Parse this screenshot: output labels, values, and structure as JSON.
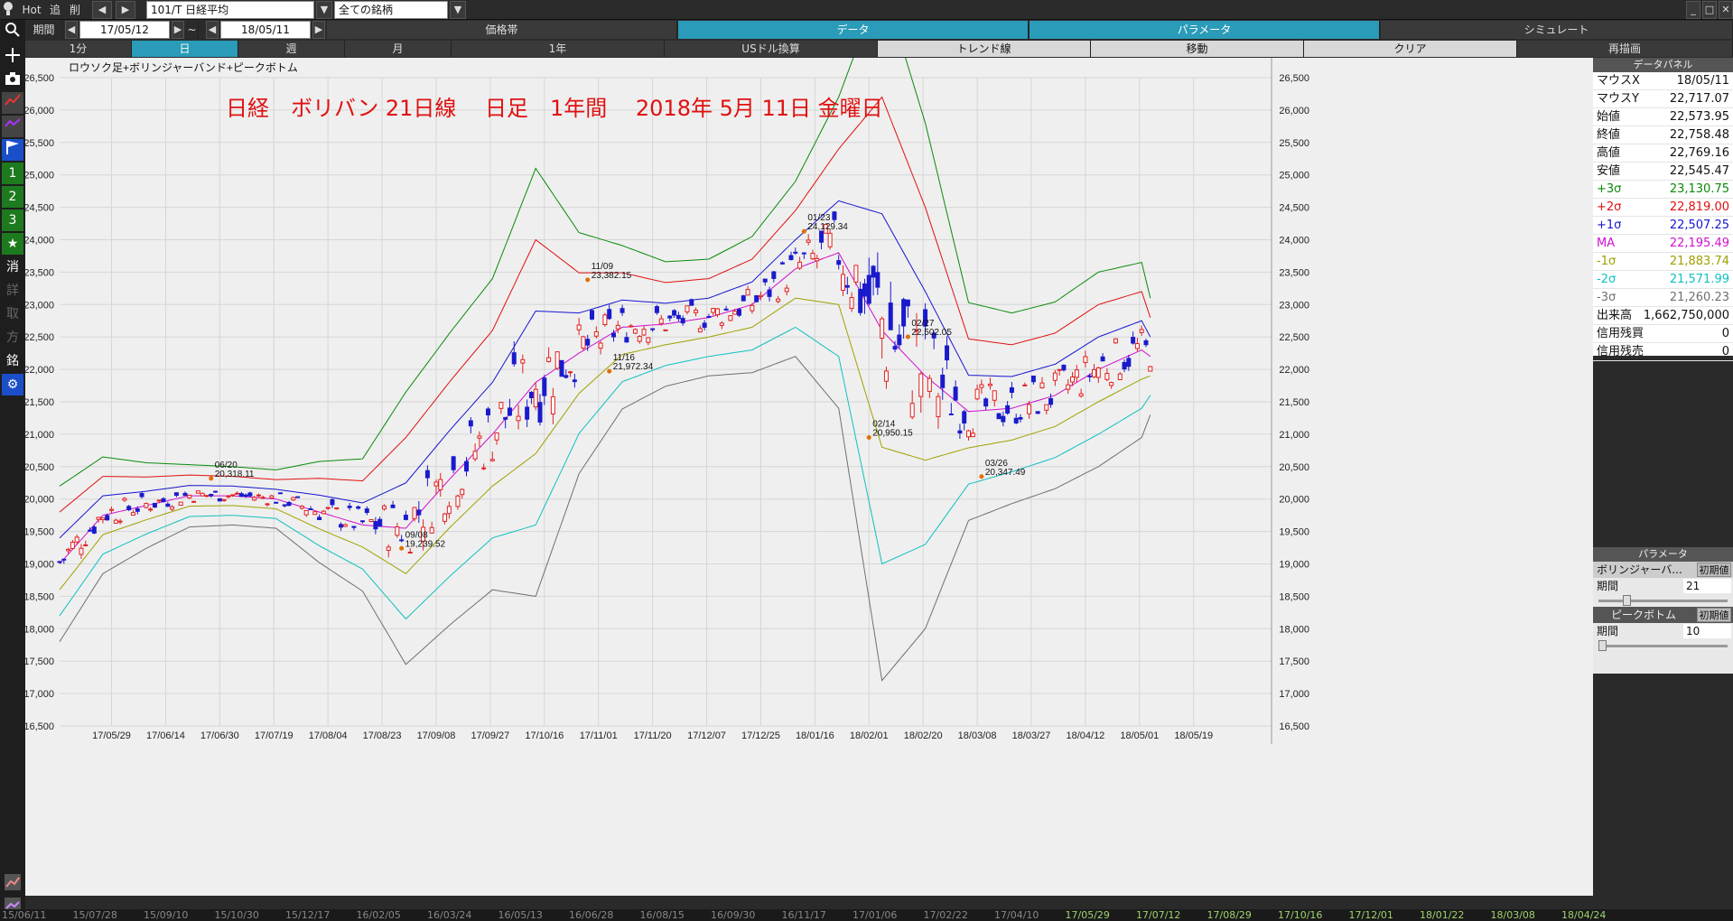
{
  "topbar": {
    "hot": "Hot",
    "tsui": "追",
    "sakujo": "削",
    "symbol": "101/T 日経平均",
    "filter": "全ての銘柄",
    "window_min": "_",
    "window_max": "□",
    "window_close": "✕"
  },
  "period_bar": {
    "label": "期間",
    "from": "17/05/12",
    "tilde": "~",
    "to": "18/05/11"
  },
  "headers": {
    "kakaku": "価格帯",
    "data": "データ",
    "param": "パラメータ",
    "sim": "シミュレート"
  },
  "tabs": {
    "t1": "1分",
    "t2": "日",
    "t3": "週",
    "t4": "月",
    "t5": "1年",
    "t6": "USドル換算",
    "t7": "トレンド線",
    "t8": "移動",
    "t9": "クリア",
    "t10": "再描画"
  },
  "chart_data": {
    "type": "candlestick",
    "subtitle": "ロウソク足+ボリンジャーバンド+ピークボトム",
    "title": "日経　ボリバン 21日線　 日足　1年間　 2018年 5月 11日 金曜日",
    "ylim": [
      16500,
      26500
    ],
    "yticks": [
      "26,500",
      "26,000",
      "25,500",
      "25,000",
      "24,500",
      "24,000",
      "23,500",
      "23,000",
      "22,500",
      "22,000",
      "21,500",
      "21,000",
      "20,500",
      "20,000",
      "19,500",
      "19,000",
      "18,500",
      "18,000",
      "17,500",
      "17,000",
      "16,500"
    ],
    "xticks": [
      "17/05/29",
      "17/06/14",
      "17/06/30",
      "17/07/19",
      "17/08/04",
      "17/08/23",
      "17/09/08",
      "17/09/27",
      "17/10/16",
      "17/11/01",
      "17/11/20",
      "17/12/07",
      "17/12/25",
      "18/01/16",
      "18/02/01",
      "18/02/20",
      "18/03/08",
      "18/03/27",
      "18/04/12",
      "18/05/01",
      "18/05/19"
    ],
    "series_colors": {
      "plus3": "#0a8a0a",
      "plus2": "#e01010",
      "plus1": "#1515d0",
      "ma": "#d010d0",
      "minus1": "#a0a000",
      "minus2": "#10c0c0",
      "minus3": "#707070",
      "up_candle": "#e02020",
      "down_candle": "#1a1acc"
    },
    "bands": {
      "x_days": [
        0,
        10,
        20,
        30,
        40,
        50,
        60,
        70,
        80,
        90,
        100,
        110,
        120,
        130,
        140,
        150,
        160,
        170,
        180,
        190,
        200,
        210,
        220,
        230,
        240,
        250,
        252
      ],
      "ma": [
        19000,
        19750,
        19900,
        20050,
        20050,
        20000,
        19800,
        19600,
        19550,
        20300,
        21000,
        21800,
        22250,
        22650,
        22700,
        22800,
        23000,
        23550,
        23800,
        22600,
        21900,
        21350,
        21400,
        21600,
        22000,
        22300,
        22200
      ],
      "sigma": [
        400,
        300,
        220,
        160,
        150,
        150,
        260,
        340,
        700,
        750,
        800,
        1100,
        620,
        420,
        320,
        300,
        350,
        450,
        800,
        1800,
        1300,
        560,
        490,
        480,
        500,
        450,
        300
      ]
    },
    "peaks": [
      {
        "date": "06/20",
        "value": "20,318.11",
        "x": 35,
        "y": 20318
      },
      {
        "date": "09/08",
        "value": "19,239.52",
        "x": 79,
        "y": 19240
      },
      {
        "date": "11/09",
        "value": "23,382.15",
        "x": 122,
        "y": 23382
      },
      {
        "date": "11/16",
        "value": "21,972.34",
        "x": 127,
        "y": 21972
      },
      {
        "date": "01/23",
        "value": "24,129.34",
        "x": 172,
        "y": 24129
      },
      {
        "date": "02/14",
        "value": "20,950.15",
        "x": 187,
        "y": 20950
      },
      {
        "date": "02/27",
        "value": "22,502.05",
        "x": 196,
        "y": 22502
      },
      {
        "date": "03/26",
        "value": "20,347.49",
        "x": 213,
        "y": 20347
      }
    ]
  },
  "data_panel": {
    "title": "データパネル",
    "rows": [
      {
        "label": "マウスX",
        "value": "18/05/11",
        "color": "#111111"
      },
      {
        "label": "マウスY",
        "value": "22,717.07",
        "color": "#111111"
      },
      {
        "label": "始値",
        "value": "22,573.95",
        "color": "#111111"
      },
      {
        "label": "終値",
        "value": "22,758.48",
        "color": "#111111"
      },
      {
        "label": "高値",
        "value": "22,769.16",
        "color": "#111111"
      },
      {
        "label": "安値",
        "value": "22,545.47",
        "color": "#111111"
      },
      {
        "label": "+3σ",
        "value": "23,130.75",
        "color": "#0a8a0a"
      },
      {
        "label": "+2σ",
        "value": "22,819.00",
        "color": "#e01010"
      },
      {
        "label": "+1σ",
        "value": "22,507.25",
        "color": "#1515d0"
      },
      {
        "label": "MA",
        "value": "22,195.49",
        "color": "#d010d0"
      },
      {
        "label": "-1σ",
        "value": "21,883.74",
        "color": "#a0a000"
      },
      {
        "label": "-2σ",
        "value": "21,571.99",
        "color": "#10c0c0"
      },
      {
        "label": "-3σ",
        "value": "21,260.23",
        "color": "#707070"
      },
      {
        "label": "出来高",
        "value": "1,662,750,000",
        "color": "#111111"
      },
      {
        "label": "信用残買",
        "value": "0",
        "color": "#111111"
      },
      {
        "label": "信用残売",
        "value": "0",
        "color": "#111111"
      }
    ]
  },
  "param_panel": {
    "title": "パラメータ",
    "boll_label": "ボリンジャーバ...",
    "boll_reset": "初期値",
    "boll_period_label": "期間",
    "boll_period_value": "21",
    "boll_slider": 0.2,
    "peak_label": "ピークボトム",
    "peak_reset": "初期値",
    "peak_period_label": "期間",
    "peak_period_value": "10",
    "peak_slider": 0.0
  },
  "bottom_dates": [
    "15/06/11",
    "15/07/28",
    "15/09/10",
    "15/10/30",
    "15/12/17",
    "16/02/05",
    "16/03/24",
    "16/05/13",
    "16/06/28",
    "16/08/15",
    "16/09/30",
    "16/11/17",
    "17/01/06",
    "17/02/22",
    "17/04/10",
    "17/05/29",
    "17/07/12",
    "17/08/29",
    "17/10/16",
    "17/12/01",
    "18/01/22",
    "18/03/08",
    "18/04/24"
  ]
}
